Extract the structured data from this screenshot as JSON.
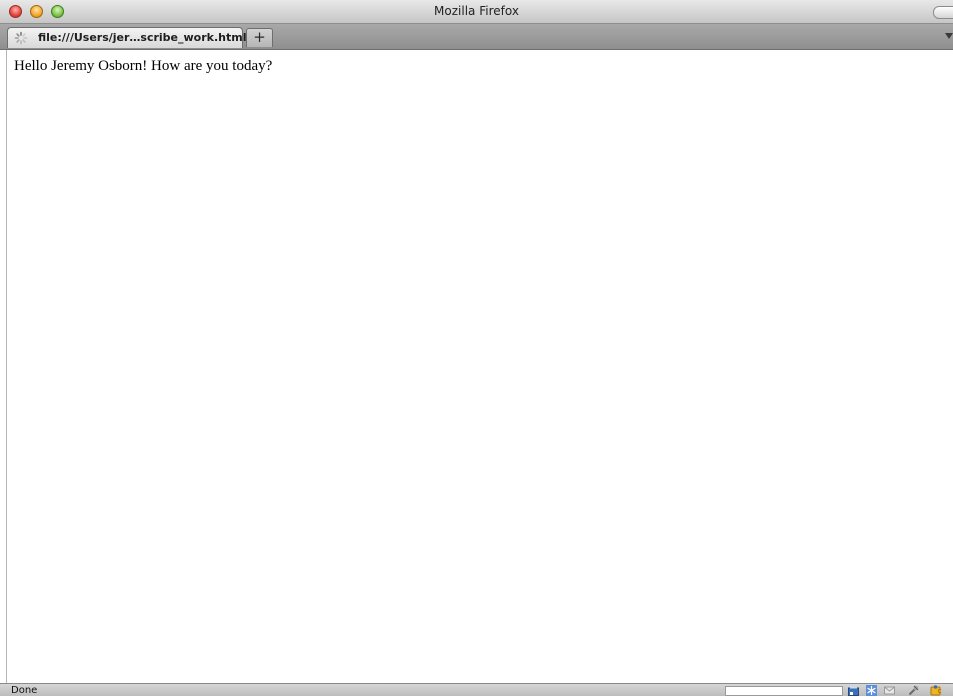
{
  "window": {
    "title": "Mozilla Firefox"
  },
  "tabs": [
    {
      "label": "file:///Users/jer…scribe_work.html",
      "loading": true
    }
  ],
  "tabstrip": {
    "new_tab_label": "+"
  },
  "page": {
    "greeting": "Hello Jeremy Osborn! How are you today?"
  },
  "status": {
    "text": "Done",
    "icons": [
      "download-icon",
      "snowflake-icon",
      "mail-icon",
      "tools-icon",
      "puzzle-icon"
    ]
  },
  "colors": {
    "close": "#e4453c",
    "minimize": "#f1a92b",
    "maximize": "#7cc44b"
  }
}
